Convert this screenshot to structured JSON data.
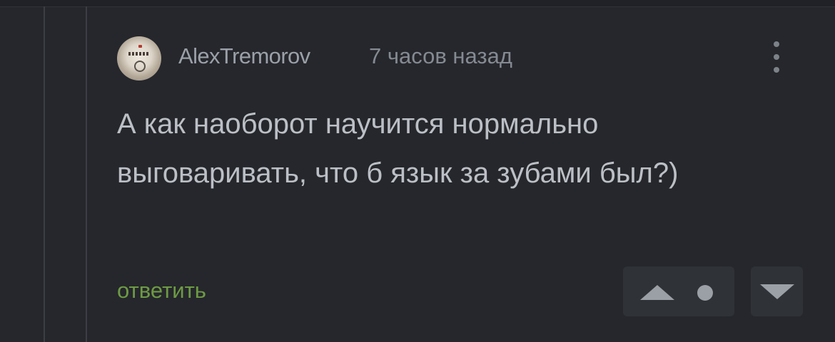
{
  "comment": {
    "author": "AlexTremorov",
    "timestamp": "7 часов назад",
    "avatar_icon": "water-meter-avatar",
    "text": "А как наоборот научится нормально выговаривать, что б язык за зубами был?)",
    "reply_label": "ответить",
    "more_icon": "vertical-ellipsis-icon",
    "upvote_icon": "triangle-up-icon",
    "rating_icon": "dot-icon",
    "downvote_icon": "triangle-down-icon"
  },
  "colors": {
    "background": "#25272c",
    "username": "#9ba0a8",
    "timestamp": "#858a92",
    "body_text": "#bcc0c6",
    "reply_link": "#6e9a44",
    "vote_button_bg": "#2f3237",
    "vote_icon": "#9b9fa6"
  }
}
